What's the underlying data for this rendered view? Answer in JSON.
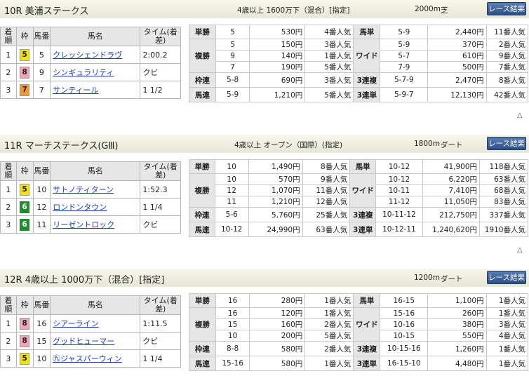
{
  "races": [
    {
      "title": "10R 美浦ステークス",
      "condition": "4歳以上 1600万下（混合）[指定]",
      "distance": "2000m",
      "surface": "芝",
      "button": "レース結果",
      "headers": {
        "rank": "着順",
        "waku": "枠",
        "umaban": "馬番",
        "horse": "馬名",
        "time": "タイム(着差)"
      },
      "rows": [
        {
          "rank": "1",
          "waku": "5",
          "waku_class": "w5",
          "num": "5",
          "name": "クレッシェンドラヴ",
          "time": "2:00.2"
        },
        {
          "rank": "2",
          "waku": "8",
          "waku_class": "w8",
          "num": "9",
          "name": "シンギュラリティ",
          "time": "クビ"
        },
        {
          "rank": "3",
          "waku": "7",
          "waku_class": "w7",
          "num": "7",
          "name": "サンティール",
          "time": "1 1/2"
        }
      ],
      "payout": {
        "tansho": {
          "label": "単勝",
          "combo": "5",
          "amount": "530円",
          "pop": "4番人気"
        },
        "umatan": {
          "label": "馬単",
          "combo": "5-9",
          "amount": "2,440円",
          "pop": "11番人気"
        },
        "fukusho": {
          "label": "複勝",
          "items": [
            {
              "combo": "5",
              "amount": "150円",
              "pop": "3番人気"
            },
            {
              "combo": "9",
              "amount": "140円",
              "pop": "1番人気"
            },
            {
              "combo": "7",
              "amount": "190円",
              "pop": "5番人気"
            }
          ]
        },
        "wide": {
          "label": "ワイド",
          "items": [
            {
              "combo": "5-9",
              "amount": "370円",
              "pop": "2番人気"
            },
            {
              "combo": "5-7",
              "amount": "610円",
              "pop": "9番人気"
            },
            {
              "combo": "7-9",
              "amount": "500円",
              "pop": "7番人気"
            }
          ]
        },
        "wakuren": {
          "label": "枠連",
          "combo": "5-8",
          "amount": "690円",
          "pop": "3番人気"
        },
        "sanrenpuku": {
          "label": "3連複",
          "combo": "5-7-9",
          "amount": "2,470円",
          "pop": "8番人気"
        },
        "umaren": {
          "label": "馬連",
          "combo": "5-9",
          "amount": "1,210円",
          "pop": "5番人気"
        },
        "sanrentan": {
          "label": "3連単",
          "combo": "5-9-7",
          "amount": "12,130円",
          "pop": "42番人気"
        }
      }
    },
    {
      "title": "11R マーチステークス(GⅢ)",
      "condition": "4歳以上 オープン（国際）(指定)",
      "distance": "1800m",
      "surface": "ダート",
      "button": "レース結果",
      "headers": {
        "rank": "着順",
        "waku": "枠",
        "umaban": "馬番",
        "horse": "馬名",
        "time": "タイム(着差)"
      },
      "rows": [
        {
          "rank": "1",
          "waku": "5",
          "waku_class": "w5",
          "num": "10",
          "name": "サトノティターン",
          "time": "1:52.3"
        },
        {
          "rank": "2",
          "waku": "6",
          "waku_class": "w6",
          "num": "12",
          "name": "ロンドンタウン",
          "time": "1 1/4"
        },
        {
          "rank": "3",
          "waku": "6",
          "waku_class": "w6",
          "num": "11",
          "name": "リーゼントロック",
          "time": "クビ"
        }
      ],
      "payout": {
        "tansho": {
          "label": "単勝",
          "combo": "10",
          "amount": "1,490円",
          "pop": "8番人気"
        },
        "umatan": {
          "label": "馬単",
          "combo": "10-12",
          "amount": "41,900円",
          "pop": "118番人気"
        },
        "fukusho": {
          "label": "複勝",
          "items": [
            {
              "combo": "10",
              "amount": "570円",
              "pop": "9番人気"
            },
            {
              "combo": "12",
              "amount": "1,070円",
              "pop": "11番人気"
            },
            {
              "combo": "11",
              "amount": "1,210円",
              "pop": "12番人気"
            }
          ]
        },
        "wide": {
          "label": "ワイド",
          "items": [
            {
              "combo": "10-12",
              "amount": "6,220円",
              "pop": "63番人気"
            },
            {
              "combo": "10-11",
              "amount": "7,410円",
              "pop": "68番人気"
            },
            {
              "combo": "11-12",
              "amount": "11,050円",
              "pop": "83番人気"
            }
          ]
        },
        "wakuren": {
          "label": "枠連",
          "combo": "5-6",
          "amount": "5,760円",
          "pop": "25番人気"
        },
        "sanrenpuku": {
          "label": "3連複",
          "combo": "10-11-12",
          "amount": "212,750円",
          "pop": "337番人気"
        },
        "umaren": {
          "label": "馬連",
          "combo": "10-12",
          "amount": "24,990円",
          "pop": "63番人気"
        },
        "sanrentan": {
          "label": "3連単",
          "combo": "10-12-11",
          "amount": "1,240,620円",
          "pop": "1910番人気"
        }
      }
    },
    {
      "title": "12R 4歳以上 1000万下（混合）[指定]",
      "condition": "",
      "distance": "1200m",
      "surface": "ダート",
      "button": "レース結果",
      "headers": {
        "rank": "着順",
        "waku": "枠",
        "umaban": "馬番",
        "horse": "馬名",
        "time": "タイム(着差)"
      },
      "rows": [
        {
          "rank": "1",
          "waku": "8",
          "waku_class": "w8",
          "num": "16",
          "name": "シアーライン",
          "time": "1:11.5"
        },
        {
          "rank": "2",
          "waku": "8",
          "waku_class": "w8",
          "num": "15",
          "name": "グッドヒューマー",
          "time": "クビ"
        },
        {
          "rank": "3",
          "waku": "5",
          "waku_class": "w5",
          "num": "10",
          "name": "㊈ジャスパーウィン",
          "time": "1 1/4"
        }
      ],
      "payout": {
        "tansho": {
          "label": "単勝",
          "combo": "16",
          "amount": "280円",
          "pop": "1番人気"
        },
        "umatan": {
          "label": "馬単",
          "combo": "16-15",
          "amount": "1,100円",
          "pop": "1番人気"
        },
        "fukusho": {
          "label": "複勝",
          "items": [
            {
              "combo": "16",
              "amount": "120円",
              "pop": "1番人気"
            },
            {
              "combo": "15",
              "amount": "160円",
              "pop": "2番人気"
            },
            {
              "combo": "10",
              "amount": "200円",
              "pop": "5番人気"
            }
          ]
        },
        "wide": {
          "label": "ワイド",
          "items": [
            {
              "combo": "15-16",
              "amount": "260円",
              "pop": "1番人気"
            },
            {
              "combo": "10-16",
              "amount": "380円",
              "pop": "3番人気"
            },
            {
              "combo": "10-15",
              "amount": "550円",
              "pop": "4番人気"
            }
          ]
        },
        "wakuren": {
          "label": "枠連",
          "combo": "8-8",
          "amount": "580円",
          "pop": "2番人気"
        },
        "sanrenpuku": {
          "label": "3連複",
          "combo": "10-15-16",
          "amount": "1,260円",
          "pop": "1番人気"
        },
        "umaren": {
          "label": "馬連",
          "combo": "15-16",
          "amount": "580円",
          "pop": "1番人気"
        },
        "sanrentan": {
          "label": "3連単",
          "combo": "16-15-10",
          "amount": "4,480円",
          "pop": "1番人気"
        }
      }
    }
  ],
  "scroll_top_icon": "△"
}
